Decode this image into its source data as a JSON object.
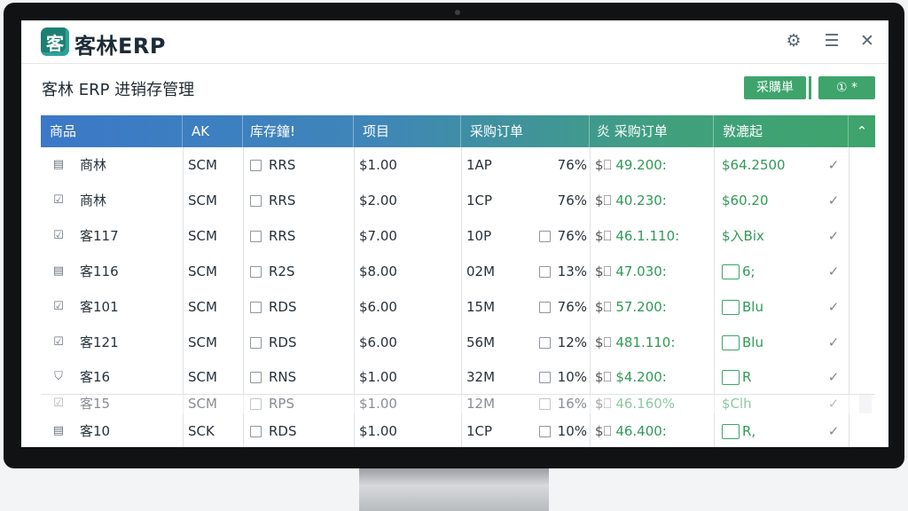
{
  "app": {
    "logo_glyph": "客",
    "name": "客林ERP",
    "title_icons": [
      "gear-icon",
      "menu-icon",
      "close-icon"
    ]
  },
  "page": {
    "title": "客林 ERP 进销存管理"
  },
  "toolbar": {
    "primary_label": "采購単",
    "secondary_label": "①  *"
  },
  "table": {
    "columns": [
      "商品",
      "AK",
      "库存鐘!",
      "项目",
      "采购订单",
      "炎 采购订单",
      "敦漉起"
    ],
    "rows": [
      {
        "name": "商林",
        "code": "SCM",
        "stock": "RRS",
        "price": "$1.00",
        "order": "1AP",
        "pct": "76%",
        "pct_box": false,
        "amount": "49.200:",
        "total": "$64.2500",
        "total_box": false
      },
      {
        "name": "商林",
        "code": "SCM",
        "stock": "RRS",
        "price": "$2.00",
        "order": "1CP",
        "pct": "76%",
        "pct_box": false,
        "amount": "40.230:",
        "total": "$60.20",
        "total_box": false
      },
      {
        "name": "客117",
        "code": "SCM",
        "stock": "RRS",
        "price": "$7.00",
        "order": "10P",
        "pct": "76%",
        "pct_box": true,
        "amount": "46.1.110:",
        "total": "$入Bix",
        "total_box": false
      },
      {
        "name": "客116",
        "code": "SCM",
        "stock": "R2S",
        "price": "$8.00",
        "order": "02M",
        "pct": "13%",
        "pct_box": true,
        "amount": "47.030:",
        "total": "6;",
        "total_box": true
      },
      {
        "name": "客101",
        "code": "SCM",
        "stock": "RDS",
        "price": "$6.00",
        "order": "15M",
        "pct": "76%",
        "pct_box": true,
        "amount": "57.200:",
        "total": "Blu",
        "total_box": true
      },
      {
        "name": "客121",
        "code": "SCM",
        "stock": "RDS",
        "price": "$6.00",
        "order": "56M",
        "pct": "12%",
        "pct_box": true,
        "amount": "481.110:",
        "total": "Blu",
        "total_box": true
      },
      {
        "name": "客16",
        "code": "SCM",
        "stock": "RNS",
        "price": "$1.00",
        "order": "32M",
        "pct": "10%",
        "pct_box": true,
        "amount": "$4.200:",
        "total": "R",
        "total_box": true
      },
      {
        "name": "客15",
        "code": "SCM",
        "stock": "RPS",
        "price": "$1.00",
        "order": "12M",
        "pct": "16%",
        "pct_box": true,
        "amount": "46.160%",
        "total": "$Clh",
        "total_box": false
      },
      {
        "name": "客10",
        "code": "SCK",
        "stock": "RDS",
        "price": "$1.00",
        "order": "1CP",
        "pct": "10%",
        "pct_box": true,
        "amount": "46.400:",
        "total": "R,",
        "total_box": true
      }
    ],
    "row_icons": [
      "doc-icon",
      "check-icon",
      "check-icon",
      "doc-icon",
      "check-icon",
      "check-icon",
      "shield-icon",
      "check-icon",
      "doc-icon"
    ],
    "colors": {
      "header_start": "#3b78c8",
      "header_end": "#3ea46a",
      "accent_green": "#2f9a55"
    }
  }
}
